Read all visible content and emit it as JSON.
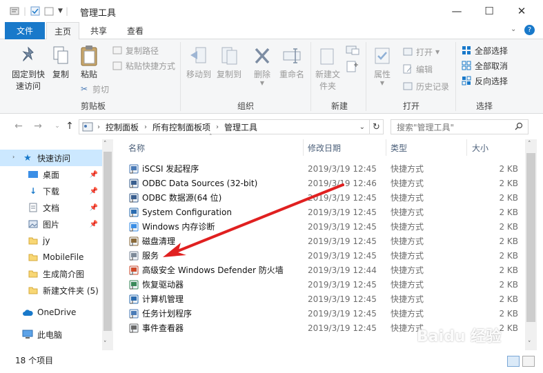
{
  "window": {
    "title": "管理工具",
    "minimize": "—",
    "maximize": "☐",
    "close": "✕"
  },
  "ribbon_tabs": [
    "文件",
    "主页",
    "共享",
    "查看"
  ],
  "ribbon": {
    "clipboard": {
      "pin_label": "固定到快速访问",
      "copy_label": "复制",
      "paste_label": "粘贴",
      "copy_path": "复制路径",
      "paste_shortcut": "粘贴快捷方式",
      "cut": "剪切",
      "group": "剪贴板"
    },
    "organize": {
      "move_to": "移动到",
      "copy_to": "复制到",
      "delete": "删除",
      "rename": "重命名",
      "group": "组织"
    },
    "new": {
      "new_folder": "新建文件夹",
      "group": "新建"
    },
    "open": {
      "properties": "属性",
      "open": "打开",
      "edit": "编辑",
      "history": "历史记录",
      "group": "打开"
    },
    "select": {
      "select_all": "全部选择",
      "select_none": "全部取消",
      "invert": "反向选择",
      "group": "选择"
    }
  },
  "address": {
    "crumbs": [
      "控制面板",
      "所有控制面板项",
      "管理工具"
    ],
    "search_placeholder": "搜索\"管理工具\""
  },
  "nav": {
    "quick_access": "快速访问",
    "items": [
      {
        "label": "桌面",
        "pinned": true
      },
      {
        "label": "下载",
        "pinned": true
      },
      {
        "label": "文档",
        "pinned": true
      },
      {
        "label": "图片",
        "pinned": true
      },
      {
        "label": "jy",
        "pinned": false
      },
      {
        "label": "MobileFile",
        "pinned": false
      },
      {
        "label": "生成简介图",
        "pinned": false
      },
      {
        "label": "新建文件夹 (5)",
        "pinned": false
      }
    ],
    "onedrive": "OneDrive",
    "this_pc": "此电脑"
  },
  "columns": {
    "name": "名称",
    "date": "修改日期",
    "type": "类型",
    "size": "大小"
  },
  "files": [
    {
      "name": "iSCSI 发起程序",
      "date": "2019/3/19 12:45",
      "type": "快捷方式",
      "size": "2 KB"
    },
    {
      "name": "ODBC Data Sources (32-bit)",
      "date": "2019/3/19 12:46",
      "type": "快捷方式",
      "size": "2 KB"
    },
    {
      "name": "ODBC 数据源(64 位)",
      "date": "2019/3/19 12:45",
      "type": "快捷方式",
      "size": "2 KB"
    },
    {
      "name": "System Configuration",
      "date": "2019/3/19 12:45",
      "type": "快捷方式",
      "size": "2 KB"
    },
    {
      "name": "Windows 内存诊断",
      "date": "2019/3/19 12:45",
      "type": "快捷方式",
      "size": "2 KB"
    },
    {
      "name": "磁盘清理",
      "date": "2019/3/19 12:45",
      "type": "快捷方式",
      "size": "2 KB"
    },
    {
      "name": "服务",
      "date": "2019/3/19 12:45",
      "type": "快捷方式",
      "size": "2 KB"
    },
    {
      "name": "高级安全 Windows Defender 防火墙",
      "date": "2019/3/19 12:44",
      "type": "快捷方式",
      "size": "2 KB"
    },
    {
      "name": "恢复驱动器",
      "date": "2019/3/19 12:45",
      "type": "快捷方式",
      "size": "2 KB"
    },
    {
      "name": "计算机管理",
      "date": "2019/3/19 12:45",
      "type": "快捷方式",
      "size": "2 KB"
    },
    {
      "name": "任务计划程序",
      "date": "2019/3/19 12:45",
      "type": "快捷方式",
      "size": "2 KB"
    },
    {
      "name": "事件查看器",
      "date": "2019/3/19 12:45",
      "type": "快捷方式",
      "size": "2 KB"
    }
  ],
  "status": {
    "count": "18 个项目"
  },
  "watermark": "Baidu 经验",
  "colors": {
    "accent": "#1979ca",
    "arrow": "#e02020"
  }
}
